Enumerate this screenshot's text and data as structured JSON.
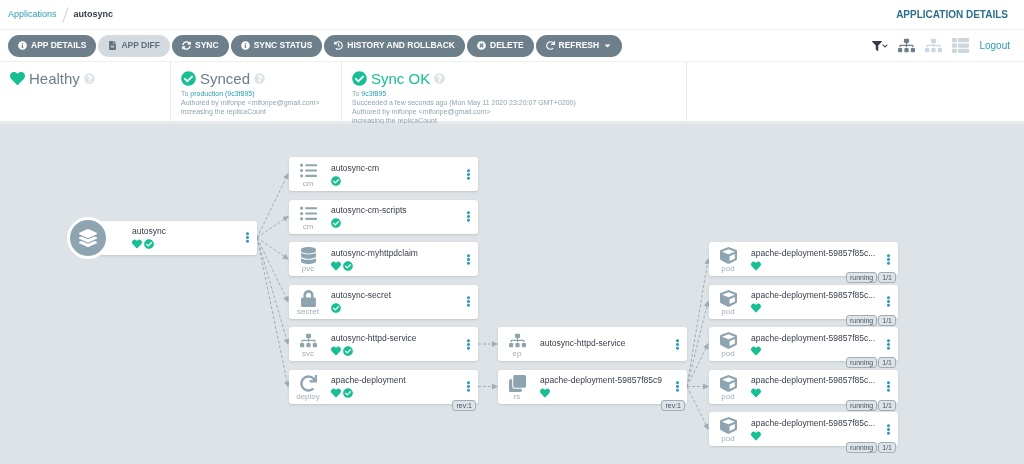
{
  "breadcrumb": [
    {
      "label": "Applications",
      "link": true
    },
    {
      "label": "autosync",
      "link": false
    }
  ],
  "page_title": "APPLICATION DETAILS",
  "toolbar": [
    {
      "label": "APP DETAILS",
      "disabled": false,
      "menu": false
    },
    {
      "label": "APP DIFF",
      "disabled": true,
      "menu": false
    },
    {
      "label": "SYNC",
      "disabled": false,
      "menu": false
    },
    {
      "label": "SYNC STATUS",
      "disabled": false,
      "menu": false
    },
    {
      "label": "HISTORY AND ROLLBACK",
      "disabled": false,
      "menu": false
    },
    {
      "label": "DELETE",
      "disabled": false,
      "menu": false
    },
    {
      "label": "REFRESH",
      "disabled": false,
      "menu": true
    }
  ],
  "view_modes": [
    {
      "kind": "tree",
      "selected": true
    },
    {
      "kind": "network",
      "selected": false
    },
    {
      "kind": "list",
      "selected": false
    }
  ],
  "logout": "Logout",
  "status": [
    {
      "kind": "health",
      "title": "Healthy"
    },
    {
      "kind": "sync",
      "title": "Synced",
      "target_prefix": "To ",
      "target": "production (9c3f895)",
      "lines": [
        "Authored by mifonpe <mifonpe@gmail.com>",
        "increasing the replicaCount"
      ]
    },
    {
      "kind": "operation",
      "title": "Sync OK",
      "target_prefix": "To ",
      "target": "9c3f895",
      "lines": [
        "Succeeded a few seconds ago (Mon May 11 2020 23:20:07 GMT+0200)",
        "Authored by mifonpe <mifonpe@gmail.com>",
        "increasing the replicaCount"
      ]
    }
  ],
  "tree": {
    "name": "autosync",
    "healthy": true,
    "synced": true,
    "children": [
      {
        "name": "autosync-cm",
        "kind": "cm",
        "synced": true
      },
      {
        "name": "autosync-cm-scripts",
        "kind": "cm",
        "synced": true
      },
      {
        "name": "autosync-myhttpdclaim",
        "kind": "pvc",
        "healthy": true,
        "synced": true
      },
      {
        "name": "autosync-secret",
        "kind": "secret",
        "synced": true
      },
      {
        "name": "autosync-httpd-service",
        "kind": "svc",
        "healthy": true,
        "synced": true,
        "children": [
          {
            "name": "autosync-httpd-service",
            "kind": "ep"
          }
        ]
      },
      {
        "name": "apache-deployment",
        "kind": "deploy",
        "healthy": true,
        "synced": true,
        "badges": [
          "rev:1"
        ],
        "children": [
          {
            "name": "apache-deployment-59857f85c9",
            "kind": "rs",
            "healthy": true,
            "badges": [
              "rev:1"
            ],
            "children": [
              {
                "name": "apache-deployment-59857f85c...",
                "kind": "pod",
                "healthy": true,
                "badges": [
                  "running",
                  "1/1"
                ]
              },
              {
                "name": "apache-deployment-59857f85c...",
                "kind": "pod",
                "healthy": true,
                "badges": [
                  "running",
                  "1/1"
                ]
              },
              {
                "name": "apache-deployment-59857f85c...",
                "kind": "pod",
                "healthy": true,
                "badges": [
                  "running",
                  "1/1"
                ]
              },
              {
                "name": "apache-deployment-59857f85c...",
                "kind": "pod",
                "healthy": true,
                "badges": [
                  "running",
                  "1/1"
                ]
              },
              {
                "name": "apache-deployment-59857f85c...",
                "kind": "pod",
                "healthy": true,
                "badges": [
                  "running",
                  "1/1"
                ]
              }
            ]
          }
        ]
      }
    ]
  }
}
